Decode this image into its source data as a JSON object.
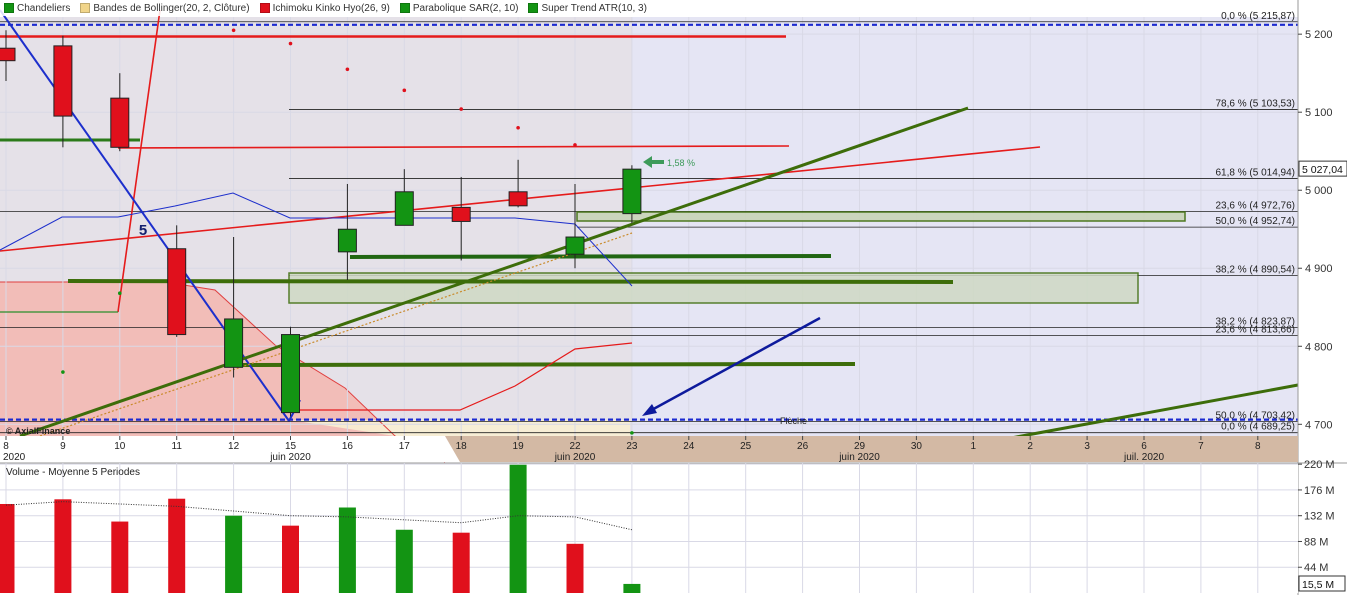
{
  "colors": {
    "up": "#139413",
    "down": "#e0101c",
    "background_future": "#e5e5f4",
    "grid": "#d9d9e6",
    "trend_green": "#3d6d0a",
    "trend_red": "#e51b1b",
    "blue_line": "#1d2fcc",
    "dashed_blue": "#1c2ad0",
    "arrow_navy": "#0d1a9c",
    "timeaxis_bg": "#d3b9a4"
  },
  "legend": [
    {
      "label": "Chandeliers",
      "color": "#139413"
    },
    {
      "label": "Bandes de Bollinger(20, 2, Clôture)",
      "color": "#f1d58a"
    },
    {
      "label": "Ichimoku Kinko Hyo(26, 9)",
      "color": "#e0101c"
    },
    {
      "label": "Parabolique SAR(2, 10)",
      "color": "#139413"
    },
    {
      "label": "Super Trend ATR(10, 3)",
      "color": "#139413"
    }
  ],
  "watermark": "© AxialFinance",
  "pattern_label": "5",
  "arrow_pct_label": "1,58 %",
  "fleche_label": "Flèche",
  "last_price": "5 027,04",
  "volume_title": "Volume  - Moyenne 5 Periodes",
  "volume_last": "15,5 M",
  "chart_data": {
    "type": "candlestick",
    "title": "",
    "y_price_ticks": [
      "5 200",
      "5 100",
      "5 000",
      "4 900",
      "4 800",
      "4 700"
    ],
    "y_price_values": [
      5200,
      5100,
      5000,
      4900,
      4800,
      4700
    ],
    "ylim": [
      4685,
      5222
    ],
    "date_labels": [
      {
        "label": "8",
        "slot": 0
      },
      {
        "label": "9",
        "slot": 1
      },
      {
        "label": "10",
        "slot": 2
      },
      {
        "label": "11",
        "slot": 3
      },
      {
        "label": "12",
        "slot": 4
      },
      {
        "label": "15",
        "slot": 5
      },
      {
        "label": "16",
        "slot": 6
      },
      {
        "label": "17",
        "slot": 7
      },
      {
        "label": "18",
        "slot": 8
      },
      {
        "label": "19",
        "slot": 9
      },
      {
        "label": "22",
        "slot": 10
      },
      {
        "label": "23",
        "slot": 11
      },
      {
        "label": "24",
        "slot": 12
      },
      {
        "label": "25",
        "slot": 13
      },
      {
        "label": "26",
        "slot": 14
      },
      {
        "label": "29",
        "slot": 15
      },
      {
        "label": "30",
        "slot": 16
      },
      {
        "label": "1",
        "slot": 17
      },
      {
        "label": "2",
        "slot": 18
      },
      {
        "label": "3",
        "slot": 19
      },
      {
        "label": "6",
        "slot": 20
      },
      {
        "label": "7",
        "slot": 21
      },
      {
        "label": "8",
        "slot": 22
      }
    ],
    "month_labels": [
      {
        "label": "2020",
        "slot": 0
      },
      {
        "label": "juin 2020",
        "slot": 5
      },
      {
        "label": "juin 2020",
        "slot": 10
      },
      {
        "label": "juin 2020",
        "slot": 15
      },
      {
        "label": "juil. 2020",
        "slot": 20
      }
    ],
    "candles": [
      {
        "date": "8",
        "open": 5182,
        "high": 5205,
        "low": 5140,
        "close": 5166
      },
      {
        "date": "9",
        "open": 5185,
        "high": 5198,
        "low": 5055,
        "close": 5095
      },
      {
        "date": "10",
        "open": 5118,
        "high": 5150,
        "low": 5050,
        "close": 5055
      },
      {
        "date": "11",
        "open": 4925,
        "high": 4955,
        "low": 4812,
        "close": 4815
      },
      {
        "date": "12",
        "open": 4773,
        "high": 4940,
        "low": 4760,
        "close": 4835
      },
      {
        "date": "15",
        "open": 4715,
        "high": 4825,
        "low": 4710,
        "close": 4815
      },
      {
        "date": "16",
        "open": 4921,
        "high": 5008,
        "low": 4885,
        "close": 4950
      },
      {
        "date": "17",
        "open": 4955,
        "high": 5027,
        "low": 4955,
        "close": 4998
      },
      {
        "date": "18",
        "open": 4978,
        "high": 5017,
        "low": 4910,
        "close": 4960
      },
      {
        "date": "19",
        "open": 4998,
        "high": 5039,
        "low": 4978,
        "close": 4980
      },
      {
        "date": "22",
        "open": 4918,
        "high": 5008,
        "low": 4900,
        "close": 4940
      },
      {
        "date": "23",
        "open": 4970,
        "high": 5032,
        "low": 4958,
        "close": 5027
      }
    ],
    "fib_levels": [
      {
        "label": "0,0 % (5 215,87)",
        "value": 5215.87
      },
      {
        "label": "78,6 % (5 103,53)",
        "value": 5103.53
      },
      {
        "label": "61,8 % (5 014,94)",
        "value": 5014.94
      },
      {
        "label": "23,6 % (4 972,76)",
        "value": 4972.76
      },
      {
        "label": "50,0 % (4 952,74)",
        "value": 4952.74
      },
      {
        "label": "38,2 % (4 890,54)",
        "value": 4890.54
      },
      {
        "label": "38,2 % (4 823,87)",
        "value": 4823.87
      },
      {
        "label": "23,6 % (4 813,66)",
        "value": 4813.66
      },
      {
        "label": "50,0 % (4 703,42)",
        "value": 4703.42
      },
      {
        "label": "0,0 % (4 689,25)",
        "value": 4689.25
      }
    ],
    "sar_points": [
      {
        "slot": 1,
        "value": 5245
      },
      {
        "slot": 3,
        "value": 5225
      },
      {
        "slot": 4,
        "value": 5205
      },
      {
        "slot": 5,
        "value": 5188
      },
      {
        "slot": 6,
        "value": 5155
      },
      {
        "slot": 7,
        "value": 5128
      },
      {
        "slot": 8,
        "value": 5104
      },
      {
        "slot": 9,
        "value": 5080
      },
      {
        "slot": 10,
        "value": 5058
      },
      {
        "slot": 2,
        "value": 4868
      },
      {
        "slot": 1,
        "value": 4767
      },
      {
        "slot": 11,
        "value": 4689
      }
    ],
    "volume": {
      "ticks": [
        "220 M",
        "176 M",
        "132 M",
        "88 M",
        "44 M"
      ],
      "tick_values": [
        220,
        176,
        132,
        88,
        44
      ],
      "ylim": [
        0,
        222
      ],
      "bars": [
        {
          "date": "8",
          "value": 152,
          "dir": "down"
        },
        {
          "date": "9",
          "value": 160,
          "dir": "down"
        },
        {
          "date": "10",
          "value": 122,
          "dir": "down"
        },
        {
          "date": "11",
          "value": 161,
          "dir": "down"
        },
        {
          "date": "12",
          "value": 132,
          "dir": "up"
        },
        {
          "date": "15",
          "value": 115,
          "dir": "down"
        },
        {
          "date": "16",
          "value": 146,
          "dir": "up"
        },
        {
          "date": "17",
          "value": 108,
          "dir": "up"
        },
        {
          "date": "18",
          "value": 103,
          "dir": "down"
        },
        {
          "date": "19",
          "value": 219,
          "dir": "up"
        },
        {
          "date": "22",
          "value": 84,
          "dir": "down"
        },
        {
          "date": "23",
          "value": 15.5,
          "dir": "up"
        }
      ],
      "ma": [
        150,
        156,
        152,
        148,
        140,
        132,
        130,
        125,
        120,
        132,
        130,
        108
      ]
    }
  }
}
